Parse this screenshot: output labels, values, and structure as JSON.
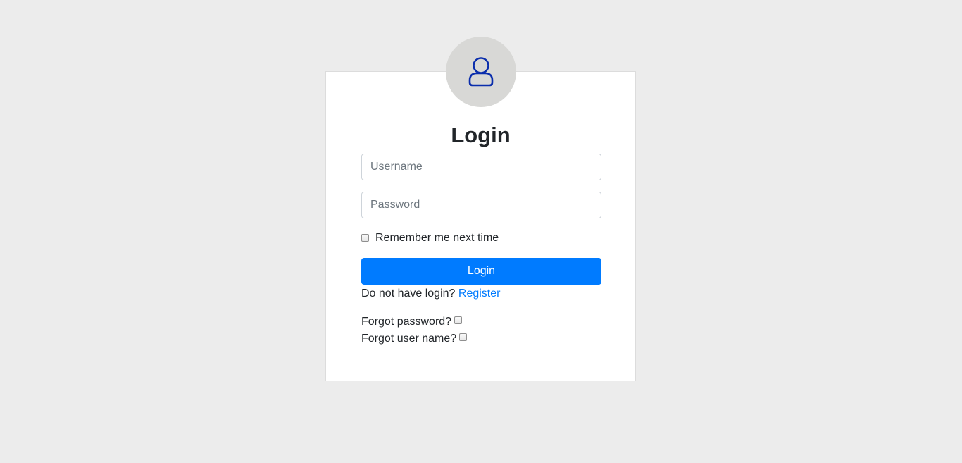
{
  "login_form": {
    "title": "Login",
    "username_placeholder": "Username",
    "password_placeholder": "Password",
    "remember_label": "Remember me next time",
    "submit_label": "Login",
    "no_login_text": "Do not have login?",
    "register_link": "Register",
    "forgot_password_label": "Forgot password?",
    "forgot_username_label": "Forgot user name?"
  },
  "colors": {
    "background": "#ececec",
    "primary": "#007bff",
    "avatar_bg": "#d8d8d6",
    "avatar_icon": "#0a2dac"
  },
  "icons": {
    "avatar": "user-icon"
  }
}
